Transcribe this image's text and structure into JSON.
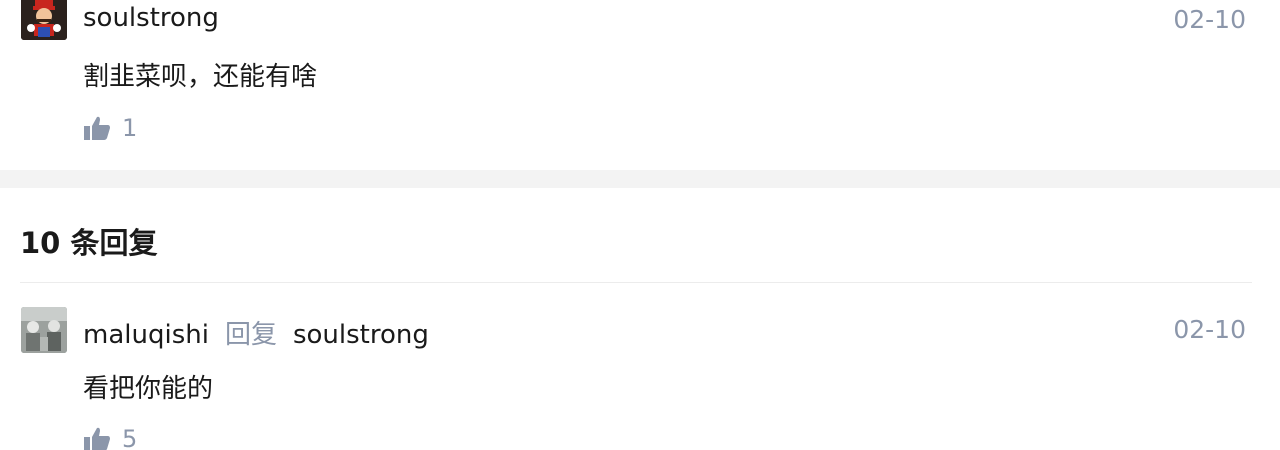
{
  "top_comment": {
    "username": "soulstrong",
    "date": "02-10",
    "text": "割韭菜呗，还能有啥",
    "likes": "1",
    "avatar_icon": "mario-avatar-icon"
  },
  "replies_header": {
    "count_label": "10 条回复"
  },
  "replies": [
    {
      "username": "maluqishi",
      "reply_word": "回复",
      "reply_to": "soulstrong",
      "date": "02-10",
      "text": "看把你能的",
      "likes": "5",
      "avatar_icon": "photo-avatar-icon"
    }
  ],
  "colors": {
    "meta_gray": "#8b96aa",
    "text": "#1a1a1a",
    "divider": "#f3f3f3"
  }
}
